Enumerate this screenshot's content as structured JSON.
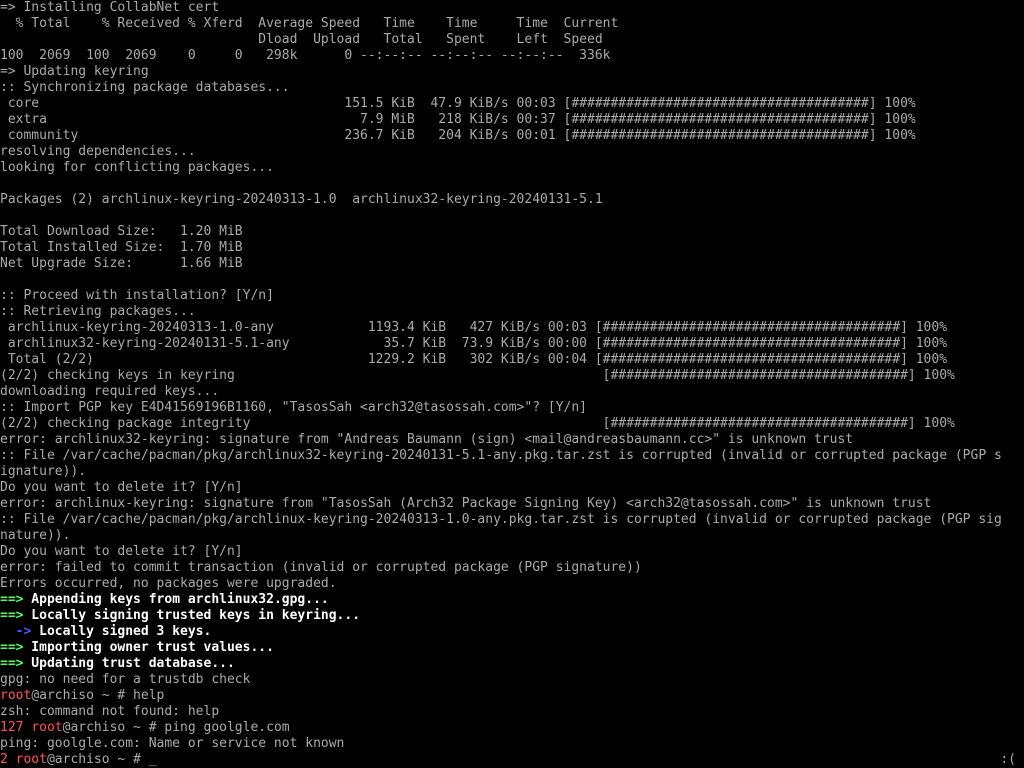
{
  "lines": [
    "=> Installing CollabNet cert",
    "  % Total    % Received % Xferd  Average Speed   Time    Time     Time  Current",
    "                                 Dload  Upload   Total   Spent    Left  Speed",
    "100  2069  100  2069    0     0   298k      0 --:--:-- --:--:-- --:--:--  336k",
    "=> Updating keyring",
    ":: Synchronizing package databases...",
    " core                                       151.5 KiB  47.9 KiB/s 00:03 [######################################] 100%",
    " extra                                        7.9 MiB   218 KiB/s 00:37 [######################################] 100%",
    " community                                  236.7 KiB   204 KiB/s 00:01 [######################################] 100%",
    "resolving dependencies...",
    "looking for conflicting packages...",
    "",
    "Packages (2) archlinux-keyring-20240313-1.0  archlinux32-keyring-20240131-5.1",
    "",
    "Total Download Size:   1.20 MiB",
    "Total Installed Size:  1.70 MiB",
    "Net Upgrade Size:      1.66 MiB",
    "",
    ":: Proceed with installation? [Y/n]",
    ":: Retrieving packages...",
    " archlinux-keyring-20240313-1.0-any            1193.4 KiB   427 KiB/s 00:03 [######################################] 100%",
    " archlinux32-keyring-20240131-5.1-any            35.7 KiB  73.9 KiB/s 00:00 [######################################] 100%",
    " Total (2/2)                                   1229.2 KiB   302 KiB/s 00:04 [######################################] 100%",
    "(2/2) checking keys in keyring                                               [######################################] 100%",
    "downloading required keys...",
    ":: Import PGP key E4D41569196B1160, \"TasosSah <arch32@tasossah.com>\"? [Y/n]",
    "(2/2) checking package integrity                                             [######################################] 100%",
    "error: archlinux32-keyring: signature from \"Andreas Baumann (sign) <mail@andreasbaumann.cc>\" is unknown trust",
    ":: File /var/cache/pacman/pkg/archlinux32-keyring-20240131-5.1-any.pkg.tar.zst is corrupted (invalid or corrupted package (PGP s",
    "ignature)).",
    "Do you want to delete it? [Y/n]",
    "error: archlinux-keyring: signature from \"TasosSah (Arch32 Package Signing Key) <arch32@tasossah.com>\" is unknown trust",
    ":: File /var/cache/pacman/pkg/archlinux-keyring-20240313-1.0-any.pkg.tar.zst is corrupted (invalid or corrupted package (PGP sig",
    "nature)).",
    "Do you want to delete it? [Y/n]",
    "error: failed to commit transaction (invalid or corrupted package (PGP signature))",
    "Errors occurred, no packages were upgraded."
  ],
  "gpg_steps": {
    "append_arrow": "==>",
    "append_text": " Appending keys from archlinux32.gpg...",
    "sign_arrow": "==>",
    "sign_text": " Locally signing trusted keys in keyring...",
    "signed_arrow": "  ->",
    "signed_text": " Locally signed 3 keys.",
    "owner_arrow": "==>",
    "owner_text": " Importing owner trust values...",
    "trust_arrow": "==>",
    "trust_text": " Updating trust database..."
  },
  "gpg_note": "gpg: no need for a trustdb check",
  "prompt1": {
    "user": "root",
    "rest": "@archiso ~ # help"
  },
  "zsh_error": "zsh: command not found: help",
  "prompt2": {
    "code": "127 ",
    "user": "root",
    "rest": "@archiso ~ # ping goolgle.com"
  },
  "ping_error": "ping: goolgle.com: Name or service not known",
  "prompt3": {
    "code": "2 ",
    "user": "root",
    "rest": "@archiso ~ # ",
    "cursor": "_"
  },
  "right_status": ":("
}
